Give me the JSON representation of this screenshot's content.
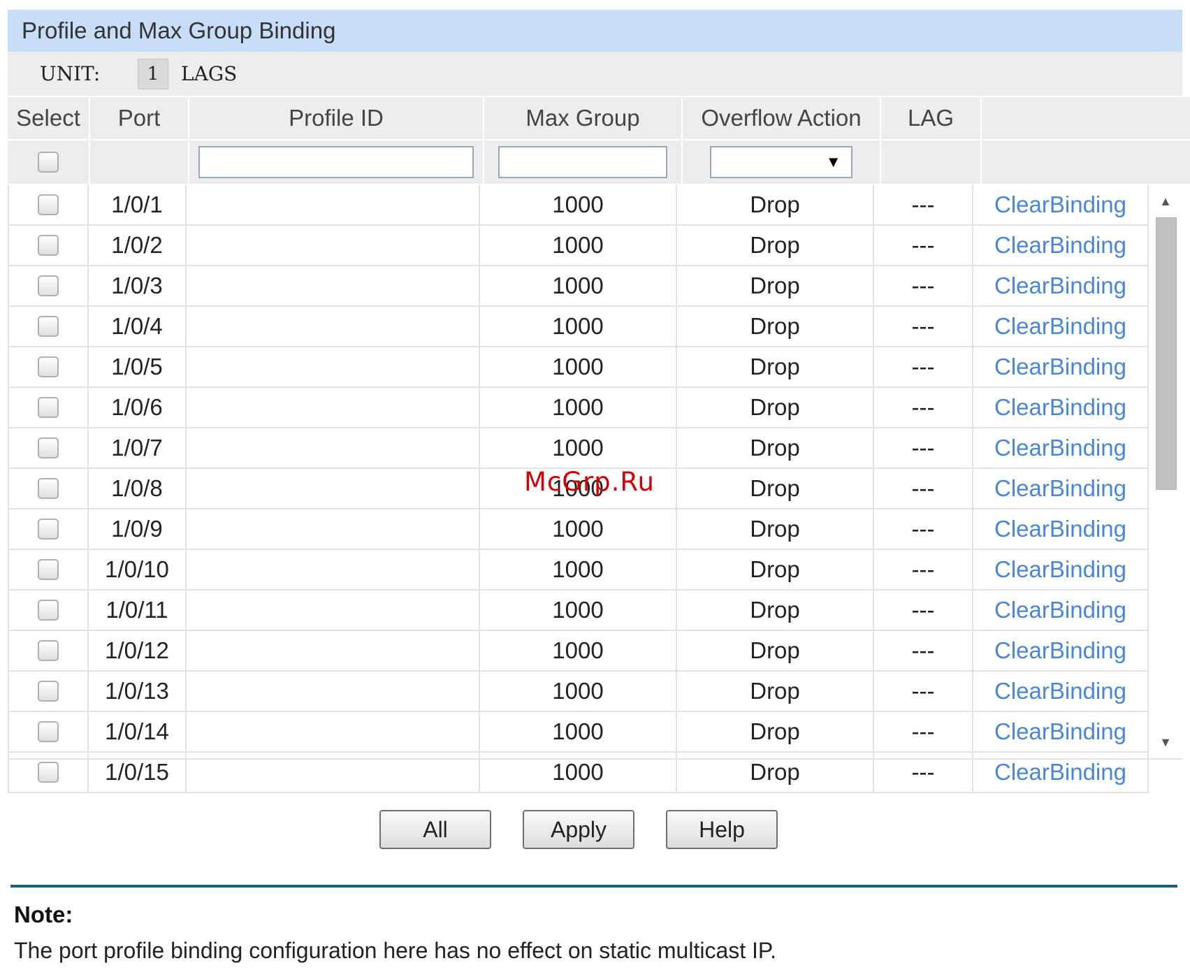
{
  "panel": {
    "title": "Profile and Max Group Binding",
    "unit_label": "UNIT:",
    "unit_value": "1",
    "lags_label": "LAGS"
  },
  "table": {
    "headers": [
      "Select",
      "Port",
      "Profile ID",
      "Max Group",
      "Overflow Action",
      "LAG",
      ""
    ],
    "filter": {
      "profile_id": "",
      "max_group": "",
      "overflow_action": "",
      "dropdown_arrow": "▼"
    },
    "rows": [
      {
        "port": "1/0/1",
        "profile_id": "",
        "max_group": "1000",
        "overflow_action": "Drop",
        "lag": "---",
        "action": "ClearBinding"
      },
      {
        "port": "1/0/2",
        "profile_id": "",
        "max_group": "1000",
        "overflow_action": "Drop",
        "lag": "---",
        "action": "ClearBinding"
      },
      {
        "port": "1/0/3",
        "profile_id": "",
        "max_group": "1000",
        "overflow_action": "Drop",
        "lag": "---",
        "action": "ClearBinding"
      },
      {
        "port": "1/0/4",
        "profile_id": "",
        "max_group": "1000",
        "overflow_action": "Drop",
        "lag": "---",
        "action": "ClearBinding"
      },
      {
        "port": "1/0/5",
        "profile_id": "",
        "max_group": "1000",
        "overflow_action": "Drop",
        "lag": "---",
        "action": "ClearBinding"
      },
      {
        "port": "1/0/6",
        "profile_id": "",
        "max_group": "1000",
        "overflow_action": "Drop",
        "lag": "---",
        "action": "ClearBinding"
      },
      {
        "port": "1/0/7",
        "profile_id": "",
        "max_group": "1000",
        "overflow_action": "Drop",
        "lag": "---",
        "action": "ClearBinding"
      },
      {
        "port": "1/0/8",
        "profile_id": "",
        "max_group": "1000",
        "overflow_action": "Drop",
        "lag": "---",
        "action": "ClearBinding"
      },
      {
        "port": "1/0/9",
        "profile_id": "",
        "max_group": "1000",
        "overflow_action": "Drop",
        "lag": "---",
        "action": "ClearBinding"
      },
      {
        "port": "1/0/10",
        "profile_id": "",
        "max_group": "1000",
        "overflow_action": "Drop",
        "lag": "---",
        "action": "ClearBinding"
      },
      {
        "port": "1/0/11",
        "profile_id": "",
        "max_group": "1000",
        "overflow_action": "Drop",
        "lag": "---",
        "action": "ClearBinding"
      },
      {
        "port": "1/0/12",
        "profile_id": "",
        "max_group": "1000",
        "overflow_action": "Drop",
        "lag": "---",
        "action": "ClearBinding"
      },
      {
        "port": "1/0/13",
        "profile_id": "",
        "max_group": "1000",
        "overflow_action": "Drop",
        "lag": "---",
        "action": "ClearBinding"
      },
      {
        "port": "1/0/14",
        "profile_id": "",
        "max_group": "1000",
        "overflow_action": "Drop",
        "lag": "---",
        "action": "ClearBinding"
      },
      {
        "port": "1/0/15",
        "profile_id": "",
        "max_group": "1000",
        "overflow_action": "Drop",
        "lag": "---",
        "action": "ClearBinding"
      }
    ]
  },
  "scrollbar": {
    "up_arrow": "▲",
    "down_arrow": "▼"
  },
  "watermark": "McGrp.Ru",
  "buttons": {
    "all": "All",
    "apply": "Apply",
    "help": "Help"
  },
  "note": {
    "title": "Note:",
    "text": "The port profile binding configuration here has no effect on static multicast IP."
  },
  "colors": {
    "title_bar": "#c8ddf7",
    "link": "#4a86d8",
    "divider": "#1e5a7a",
    "watermark": "#d10000"
  }
}
